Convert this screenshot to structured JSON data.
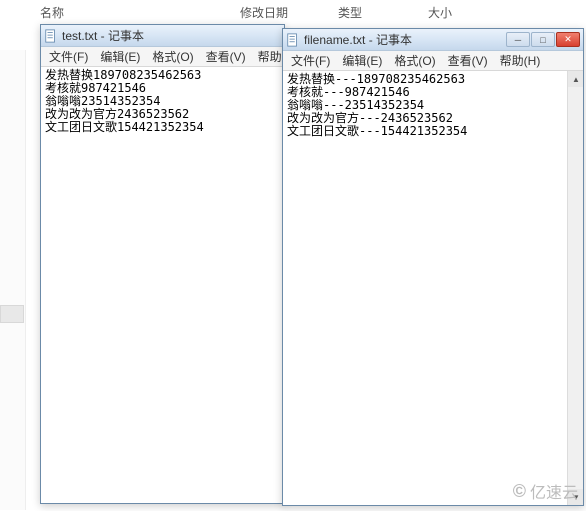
{
  "explorer": {
    "columns": {
      "name": "名称",
      "date": "修改日期",
      "type": "类型",
      "size": "大小"
    }
  },
  "window_back": {
    "title": "test.txt - 记事本",
    "menu": {
      "file": "文件(F)",
      "edit": "编辑(E)",
      "format": "格式(O)",
      "view": "查看(V)",
      "help": "帮助(H)"
    },
    "content": "发热替换189708235462563\n考核就987421546\n翁嗡嗡23514352354\n改为改为官方2436523562\n文工团日文歌154421352354"
  },
  "window_front": {
    "title": "filename.txt - 记事本",
    "menu": {
      "file": "文件(F)",
      "edit": "编辑(E)",
      "format": "格式(O)",
      "view": "查看(V)",
      "help": "帮助(H)"
    },
    "content": "发热替换---189708235462563\n考核就---987421546\n翁嗡嗡---23514352354\n改为改为官方---2436523562\n文工团日文歌---154421352354"
  },
  "window_controls": {
    "minimize": "─",
    "maximize": "□",
    "close": "✕"
  },
  "scroll": {
    "up": "▲",
    "down": "▼"
  },
  "watermark": {
    "icon": "©",
    "text": "亿速云"
  }
}
